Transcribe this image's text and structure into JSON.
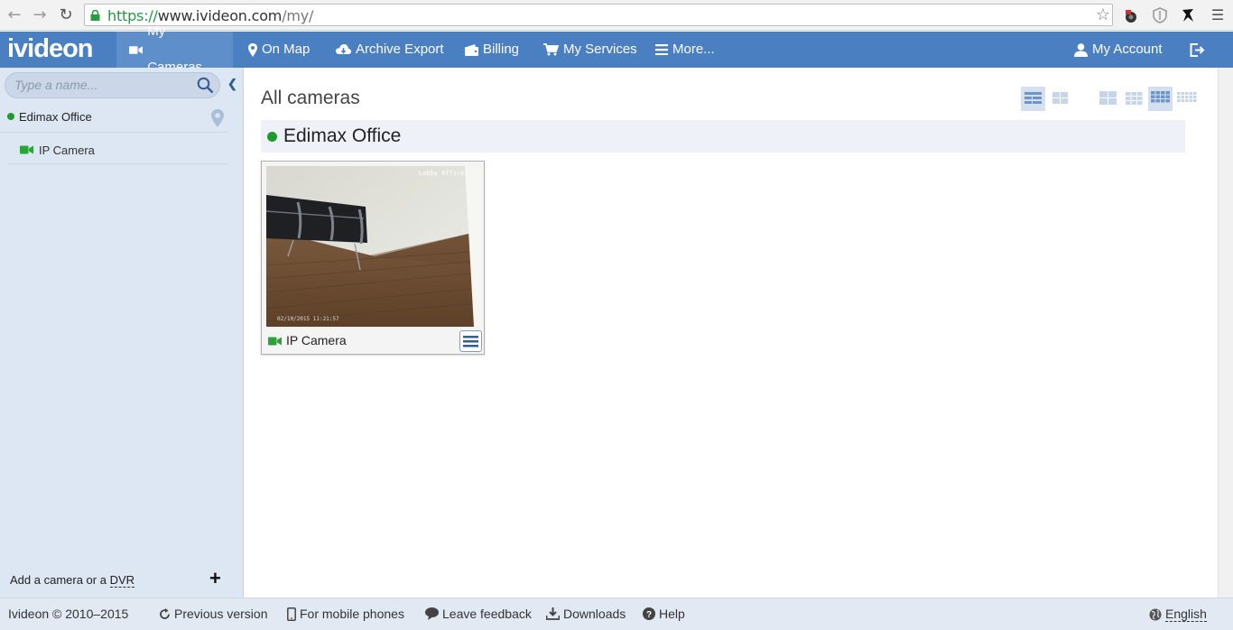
{
  "browser": {
    "url_scheme": "https://",
    "url_host": "www.ivideon.com",
    "url_path": "/my/"
  },
  "app": {
    "logo": "ivideon",
    "nav": {
      "my_cameras": "My Cameras",
      "on_map": "On Map",
      "archive_export": "Archive Export",
      "billing": "Billing",
      "my_services": "My Services",
      "more": "More...",
      "my_account": "My Account"
    },
    "accent_color": "#4a7fc1",
    "status_online_color": "#1f9a2c"
  },
  "sidebar": {
    "search_placeholder": "Type a name...",
    "group_name": "Edimax Office",
    "camera_name": "IP Camera",
    "add_text": "Add a camera or a ",
    "add_dvr": "DVR"
  },
  "main": {
    "title": "All cameras",
    "group_title": "Edimax Office",
    "camera": {
      "name": "IP Camera",
      "overlay_label": "Lobby Office",
      "timestamp": "02/10/2015 11:21:57"
    }
  },
  "footer": {
    "copyright": "Ivideon © 2010–2015",
    "previous_version": "Previous version",
    "mobile": "For mobile phones",
    "feedback": "Leave feedback",
    "downloads": "Downloads",
    "help": "Help",
    "language": "English"
  }
}
